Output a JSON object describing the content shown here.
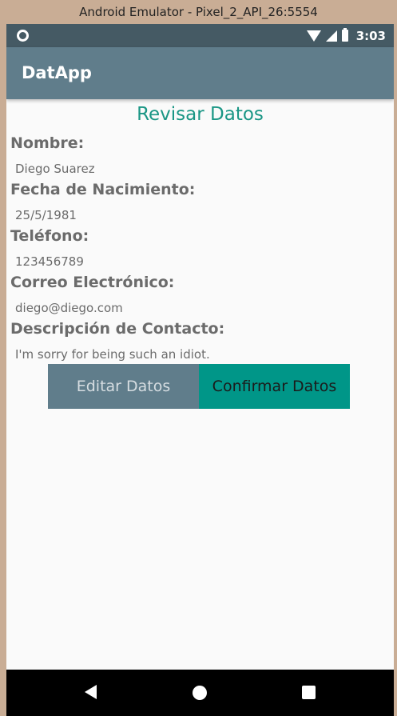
{
  "window": {
    "title": "Android Emulator - Pixel_2_API_26:5554"
  },
  "status_bar": {
    "time": "3:03"
  },
  "app_bar": {
    "title": "DatApp"
  },
  "page": {
    "title": "Revisar Datos",
    "fields": [
      {
        "label": "Nombre:",
        "value": "Diego Suarez"
      },
      {
        "label": "Fecha de Nacimiento:",
        "value": "25/5/1981"
      },
      {
        "label": "Teléfono:",
        "value": "123456789"
      },
      {
        "label": "Correo Electrónico:",
        "value": "diego@diego.com"
      },
      {
        "label": "Descripción de Contacto:",
        "value": "I'm sorry for being such an idiot."
      }
    ]
  },
  "buttons": {
    "edit_label": "Editar Datos",
    "confirm_label": "Confirmar Datos"
  },
  "colors": {
    "primary": "#607d8b",
    "primary_dark": "#455a64",
    "accent": "#009688"
  },
  "icons": {
    "status_left": "circle-notification-icon",
    "status_right": [
      "wifi-icon",
      "cell-signal-icon",
      "battery-icon"
    ],
    "nav": [
      "back-icon",
      "home-icon",
      "recents-icon"
    ]
  }
}
